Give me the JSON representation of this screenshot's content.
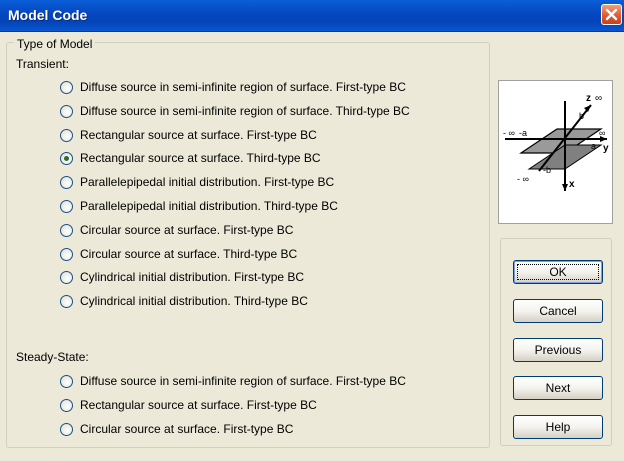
{
  "window": {
    "title": "Model Code"
  },
  "group": {
    "title": "Type of Model",
    "transient_label": "Transient:",
    "steady_label": "Steady-State:",
    "transient_options": [
      {
        "label": "Diffuse source in semi-infinite region of surface. First-type BC",
        "checked": false
      },
      {
        "label": "Diffuse source in semi-infinite region of surface. Third-type BC",
        "checked": false
      },
      {
        "label": "Rectangular source at surface. First-type BC",
        "checked": false
      },
      {
        "label": "Rectangular source at surface. Third-type BC",
        "checked": true
      },
      {
        "label": "Parallelepipedal initial distribution. First-type BC",
        "checked": false
      },
      {
        "label": "Parallelepipedal initial distribution. Third-type BC",
        "checked": false
      },
      {
        "label": "Circular source at surface. First-type BC",
        "checked": false
      },
      {
        "label": "Circular source at surface. Third-type BC",
        "checked": false
      },
      {
        "label": "Cylindrical initial distribution. First-type BC",
        "checked": false
      },
      {
        "label": "Cylindrical initial distribution. Third-type BC",
        "checked": false
      }
    ],
    "steady_options": [
      {
        "label": "Diffuse source in semi-infinite region of surface. First-type BC",
        "checked": false
      },
      {
        "label": "Rectangular source at surface. First-type BC",
        "checked": false
      },
      {
        "label": "Circular source at surface. First-type BC",
        "checked": false
      }
    ]
  },
  "diagram": {
    "labels": {
      "z": "z",
      "inf_z": "∞",
      "x": "x",
      "y": "y",
      "b": "b",
      "a": "a",
      "neg_inf": "- ∞",
      "neg_a": "-a",
      "neg_b": "-b",
      "inf_y": "∞"
    }
  },
  "buttons": {
    "ok": "OK",
    "cancel": "Cancel",
    "previous": "Previous",
    "next": "Next",
    "help": "Help"
  },
  "colors": {
    "title_bar": "#0a5fd8",
    "dialog_bg": "#ece9d8",
    "close_button": "#e15a32"
  }
}
